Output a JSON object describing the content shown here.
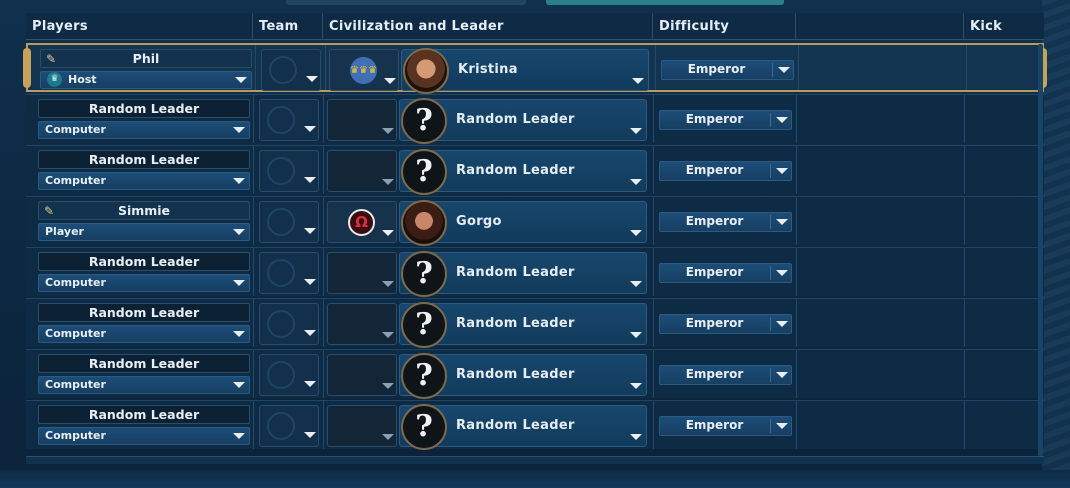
{
  "header": {
    "columns": [
      "Players",
      "Team",
      "Civilization and Leader",
      "Difficulty",
      "",
      "Kick Player"
    ]
  },
  "rows": [
    {
      "name": "Phil",
      "role": "Host",
      "host": true,
      "editable": true,
      "civ": "sweden",
      "leader": "Kristina",
      "portrait": "kristina",
      "difficulty": "Emperor",
      "selected": true
    },
    {
      "name": "Random Leader",
      "role": "Computer",
      "host": false,
      "editable": false,
      "civ": "",
      "leader": "Random Leader",
      "portrait": "random",
      "difficulty": "Emperor",
      "selected": false
    },
    {
      "name": "Random Leader",
      "role": "Computer",
      "host": false,
      "editable": false,
      "civ": "",
      "leader": "Random Leader",
      "portrait": "random",
      "difficulty": "Emperor",
      "selected": false
    },
    {
      "name": "Simmie",
      "role": "Player",
      "host": false,
      "editable": true,
      "civ": "greece",
      "leader": "Gorgo",
      "portrait": "gorgo",
      "difficulty": "Emperor",
      "selected": false
    },
    {
      "name": "Random Leader",
      "role": "Computer",
      "host": false,
      "editable": false,
      "civ": "",
      "leader": "Random Leader",
      "portrait": "random",
      "difficulty": "Emperor",
      "selected": false
    },
    {
      "name": "Random Leader",
      "role": "Computer",
      "host": false,
      "editable": false,
      "civ": "",
      "leader": "Random Leader",
      "portrait": "random",
      "difficulty": "Emperor",
      "selected": false
    },
    {
      "name": "Random Leader",
      "role": "Computer",
      "host": false,
      "editable": false,
      "civ": "",
      "leader": "Random Leader",
      "portrait": "random",
      "difficulty": "Emperor",
      "selected": false
    },
    {
      "name": "Random Leader",
      "role": "Computer",
      "host": false,
      "editable": false,
      "civ": "",
      "leader": "Random Leader",
      "portrait": "random",
      "difficulty": "Emperor",
      "selected": false
    }
  ],
  "icons": {
    "pencil": "✎",
    "crown": "♛",
    "random_portrait": "?",
    "sweden_emblem": "♛♛♛",
    "greece_emblem": "Ω"
  },
  "colors": {
    "selected_border": "#b99a5a",
    "panel_bg": "#0e2b45",
    "dropdown_bg": "#1c4d78"
  }
}
